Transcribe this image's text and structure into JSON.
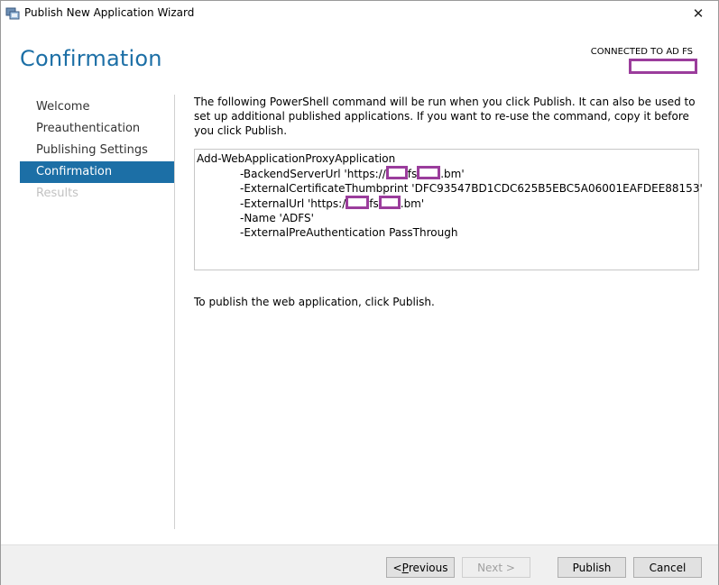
{
  "window": {
    "title": "Publish New Application Wizard",
    "close_glyph": "✕"
  },
  "header": {
    "page_title": "Confirmation",
    "connected_label": "CONNECTED TO AD FS"
  },
  "nav": {
    "items": [
      {
        "label": "Welcome",
        "state": "normal"
      },
      {
        "label": "Preauthentication",
        "state": "normal"
      },
      {
        "label": "Publishing Settings",
        "state": "normal"
      },
      {
        "label": "Confirmation",
        "state": "selected"
      },
      {
        "label": "Results",
        "state": "disabled"
      }
    ]
  },
  "content": {
    "intro": "The following PowerShell command will be run when you click Publish. It can also be used to set up additional published applications. If you want to re-use the command, copy it before you click Publish.",
    "command": {
      "cmdlet": "Add-WebApplicationProxyApplication",
      "backend_prefix": "-BackendServerUrl 'https://",
      "backend_mid": "fs",
      "backend_suffix": ".bm'",
      "thumbprint": "-ExternalCertificateThumbprint 'DFC93547BD1CDC625B5EBC5A06001EAFDEE88153'",
      "external_prefix": "-ExternalUrl 'https:/",
      "external_mid": "fs",
      "external_suffix": ".bm'",
      "name": "-Name 'ADFS'",
      "preauth": "-ExternalPreAuthentication PassThrough"
    },
    "hint": "To publish the web application, click Publish."
  },
  "footer": {
    "previous_prefix": "< ",
    "previous_accel": "P",
    "previous_rest": "revious",
    "next_label": "Next >",
    "publish_label": "Publish",
    "cancel_label": "Cancel"
  },
  "colors": {
    "accent": "#1c6fa6",
    "redaction": "#9b3d9c"
  }
}
